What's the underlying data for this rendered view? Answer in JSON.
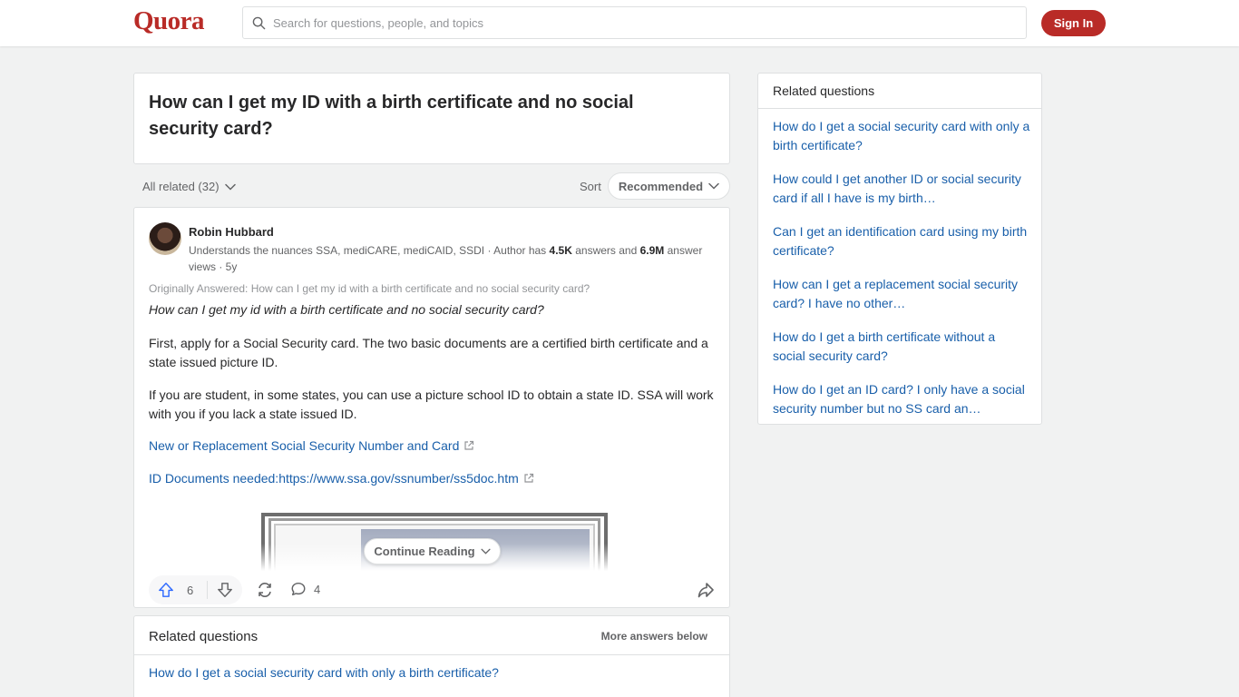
{
  "header": {
    "logo": "Quora",
    "search_placeholder": "Search for questions, people, and topics",
    "signin_label": "Sign In"
  },
  "question": {
    "title": "How can I get my ID with a birth certificate and no social security card?"
  },
  "filters": {
    "all_related": "All related (32)",
    "sort_label": "Sort",
    "sort_value": "Recommended"
  },
  "answer": {
    "author": "Robin Hubbard",
    "cred_prefix": "Understands the nuances SSA, mediCARE, mediCAID, SSDI · Author has ",
    "answers_count": "4.5K",
    "cred_mid": " answers and ",
    "views_count": "6.9M",
    "cred_suffix": " answer views · 5y",
    "originally_answered": "Originally Answered: How can I get my id with a birth certificate and no social security card?",
    "orig_question": "How can I get my id with a birth certificate and no social security card?",
    "paragraph1": "First, apply for a Social Security card. The two basic documents are a certified birth certificate and a state issued picture ID.",
    "paragraph2": "If you are student, in some states, you can use a picture school ID to obtain a state ID. SSA will work with you if you lack a state issued ID.",
    "link1": "New or Replacement Social Security Number and Card",
    "link2_prefix": "ID Documents needed: ",
    "link2_url": "https://www.ssa.gov/ssnumber/ss5doc.htm",
    "continue_label": "Continue Reading",
    "upvotes": "6",
    "comments": "4"
  },
  "related_bottom": {
    "title": "Related questions",
    "more": "More answers below",
    "first_link": "How do I get a social security card with only a birth certificate?"
  },
  "related_side": {
    "title": "Related questions",
    "items": [
      "How do I get a social security card with only a birth certificate?",
      "How could I get another ID or social security card if all I have is my birth…",
      "Can I get an identification card using my birth certificate?",
      "How can I get a replacement social security card? I have no other…",
      "How do I get a birth certificate without a social security card?",
      "How do I get an ID card? I only have a social security number but no SS card an…"
    ]
  },
  "colors": {
    "brand": "#b92b27",
    "link": "#195faa",
    "upvote": "#2e69ff"
  }
}
